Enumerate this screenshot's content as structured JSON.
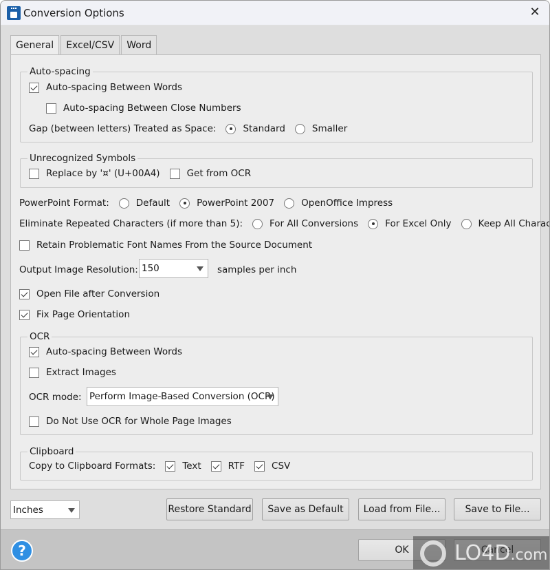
{
  "window": {
    "title": "Conversion Options"
  },
  "tabs": [
    {
      "label": "General",
      "active": true
    },
    {
      "label": "Excel/CSV",
      "active": false
    },
    {
      "label": "Word",
      "active": false
    }
  ],
  "auto_spacing": {
    "group_label": "Auto-spacing",
    "between_words": {
      "label": "Auto-spacing Between Words",
      "checked": true
    },
    "between_close_numbers": {
      "label": "Auto-spacing Between Close Numbers",
      "checked": false
    },
    "gap_label": "Gap (between letters) Treated as Space:",
    "gap_options": [
      {
        "label": "Standard",
        "selected": true
      },
      {
        "label": "Smaller",
        "selected": false
      }
    ]
  },
  "unrecognized_symbols": {
    "group_label": "Unrecognized Symbols",
    "replace_by": {
      "label": "Replace by '¤' (U+00A4)",
      "checked": false
    },
    "get_from_ocr": {
      "label": "Get from OCR",
      "checked": false
    }
  },
  "powerpoint_format": {
    "label": "PowerPoint Format:",
    "options": [
      {
        "label": "Default",
        "selected": false
      },
      {
        "label": "PowerPoint 2007",
        "selected": true
      },
      {
        "label": "OpenOffice Impress",
        "selected": false
      }
    ]
  },
  "eliminate_repeated": {
    "label": "Eliminate Repeated Characters (if more than 5):",
    "options": [
      {
        "label": "For All Conversions",
        "selected": false
      },
      {
        "label": "For Excel Only",
        "selected": true
      },
      {
        "label": "Keep All Characters",
        "selected": false
      }
    ]
  },
  "retain_font_names": {
    "label": "Retain Problematic Font Names From the Source Document",
    "checked": false
  },
  "output_resolution": {
    "label": "Output Image Resolution:",
    "value": "150",
    "unit": "samples per inch"
  },
  "open_file_after": {
    "label": "Open File after Conversion",
    "checked": true
  },
  "fix_page_orientation": {
    "label": "Fix Page Orientation",
    "checked": true
  },
  "ocr": {
    "group_label": "OCR",
    "auto_spacing": {
      "label": "Auto-spacing Between Words",
      "checked": true
    },
    "extract_images": {
      "label": "Extract Images",
      "checked": false
    },
    "mode_label": "OCR mode:",
    "mode_value": "Perform Image-Based Conversion (OCR)",
    "no_ocr_whole_page": {
      "label": "Do Not Use OCR for Whole Page Images",
      "checked": false
    }
  },
  "clipboard": {
    "group_label": "Clipboard",
    "formats_label": "Copy to Clipboard Formats:",
    "formats": [
      {
        "label": "Text",
        "checked": true
      },
      {
        "label": "RTF",
        "checked": true
      },
      {
        "label": "CSV",
        "checked": true
      }
    ]
  },
  "units": {
    "value": "Inches"
  },
  "buttons": {
    "restore_standard": "Restore Standard",
    "save_as_default": "Save as Default",
    "load_from_file": "Load from File...",
    "save_to_file": "Save to File...",
    "ok": "OK",
    "cancel": "Cancel"
  },
  "footer": {
    "help_glyph": "?"
  },
  "watermark": {
    "text": "LO4D",
    "suffix": ".com"
  }
}
